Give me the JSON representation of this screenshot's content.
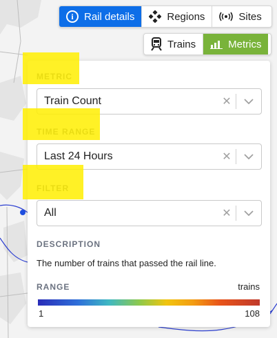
{
  "toolbar_top": {
    "rail_details_label": "Rail details",
    "regions_label": "Regions",
    "sites_label": "Sites"
  },
  "toolbar_bottom": {
    "trains_label": "Trains",
    "metrics_label": "Metrics"
  },
  "panel": {
    "metric": {
      "label": "METRIC",
      "value": "Train Count"
    },
    "time_range": {
      "label": "TIME RANGE",
      "value": "Last 24 Hours"
    },
    "filter": {
      "label": "FILTER",
      "value": "All"
    },
    "description": {
      "label": "DESCRIPTION",
      "text": "The number of trains that passed the rail line."
    },
    "range": {
      "label": "RANGE",
      "unit": "trains",
      "min": "1",
      "max": "108"
    }
  },
  "icons": {
    "info": "info-icon",
    "regions": "diamond-cluster-icon",
    "sites": "broadcast-icon",
    "trains": "train-icon",
    "metrics": "bar-chart-icon",
    "clear": "close-icon",
    "chevron": "chevron-down-icon"
  },
  "colors": {
    "active_blue": "#0d6ee8",
    "active_green": "#79b33a",
    "highlight": "#ffee00"
  }
}
